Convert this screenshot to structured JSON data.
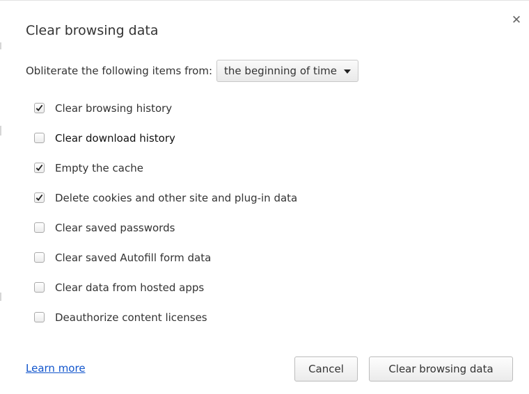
{
  "dialog": {
    "title": "Clear browsing data",
    "close_icon": "close-icon"
  },
  "range": {
    "label": "Obliterate the following items from:",
    "selected": "the beginning of time",
    "dropdown_icon": "chevron-down-icon"
  },
  "options": [
    {
      "label": "Clear browsing history",
      "checked": true
    },
    {
      "label": "Clear download history",
      "checked": false
    },
    {
      "label": "Empty the cache",
      "checked": true
    },
    {
      "label": "Delete cookies and other site and plug-in data",
      "checked": true
    },
    {
      "label": "Clear saved passwords",
      "checked": false
    },
    {
      "label": "Clear saved Autofill form data",
      "checked": false
    },
    {
      "label": "Clear data from hosted apps",
      "checked": false
    },
    {
      "label": "Deauthorize content licenses",
      "checked": false
    }
  ],
  "footer": {
    "learn_more": "Learn more",
    "cancel_label": "Cancel",
    "confirm_label": "Clear browsing data"
  },
  "colors": {
    "link": "#1155cc",
    "text": "#333333",
    "button_border": "#bcbcbc"
  }
}
